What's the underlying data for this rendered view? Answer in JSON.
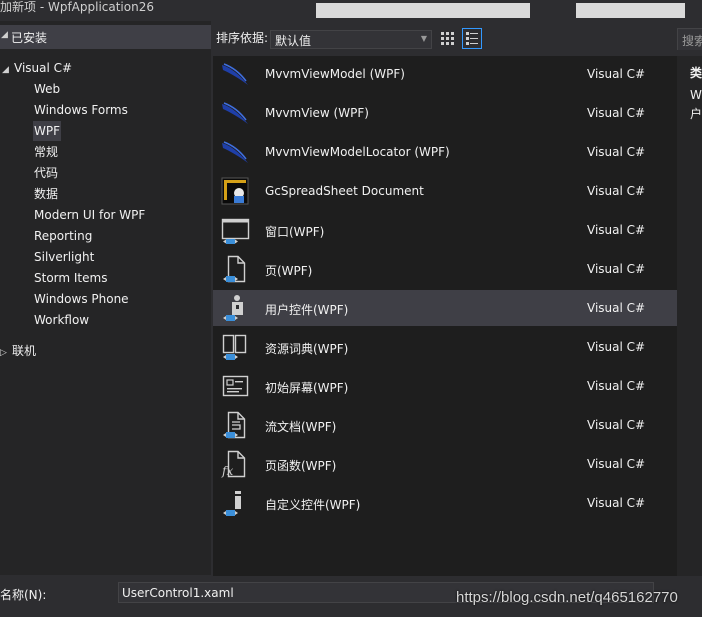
{
  "window": {
    "title": "加新项 - WpfApplication26"
  },
  "tree": {
    "installed_label": "已安装",
    "root": {
      "label": "Visual C#",
      "children": [
        "Web",
        "Windows Forms",
        "WPF",
        "常规",
        "代码",
        "数据",
        "Modern UI for WPF",
        "Reporting",
        "Silverlight",
        "Storm Items",
        "Windows Phone",
        "Workflow"
      ]
    },
    "selected": "WPF",
    "online_label": "联机"
  },
  "toolbar": {
    "sort_label": "排序依据:",
    "sort_value": "默认值",
    "search_placeholder": "搜索"
  },
  "templates": [
    {
      "name": "MvvmViewModel (WPF)",
      "lang": "Visual C#",
      "icon": "mvvm-swoosh-icon"
    },
    {
      "name": "MvvmView (WPF)",
      "lang": "Visual C#",
      "icon": "mvvm-swoosh-icon"
    },
    {
      "name": "MvvmViewModelLocator (WPF)",
      "lang": "Visual C#",
      "icon": "mvvm-swoosh-icon"
    },
    {
      "name": "GcSpreadSheet Document",
      "lang": "Visual C#",
      "icon": "spreadsheet-doc-icon"
    },
    {
      "name": "窗口(WPF)",
      "lang": "Visual C#",
      "icon": "window-icon"
    },
    {
      "name": "页(WPF)",
      "lang": "Visual C#",
      "icon": "page-icon"
    },
    {
      "name": "用户控件(WPF)",
      "lang": "Visual C#",
      "icon": "user-control-icon"
    },
    {
      "name": "资源词典(WPF)",
      "lang": "Visual C#",
      "icon": "resource-dictionary-icon"
    },
    {
      "name": "初始屏幕(WPF)",
      "lang": "Visual C#",
      "icon": "splash-screen-icon"
    },
    {
      "name": "流文档(WPF)",
      "lang": "Visual C#",
      "icon": "flow-document-icon"
    },
    {
      "name": "页函数(WPF)",
      "lang": "Visual C#",
      "icon": "page-function-icon"
    },
    {
      "name": "自定义控件(WPF)",
      "lang": "Visual C#",
      "icon": "custom-control-icon"
    }
  ],
  "selected_template": "用户控件(WPF)",
  "details": {
    "type_label": "类",
    "desc_line1": "W",
    "desc_line2": "户"
  },
  "bottom": {
    "name_label": "名称(N):",
    "name_value": "UserControl1.xaml"
  },
  "watermark": "https://blog.csdn.net/q465162770",
  "colors": {
    "background": "#2d2d30",
    "panel": "#252526",
    "list": "#1e1e1e",
    "selection": "#3f3f46",
    "accent": "#3399ff",
    "icon_blue": "#3b8fd9"
  }
}
